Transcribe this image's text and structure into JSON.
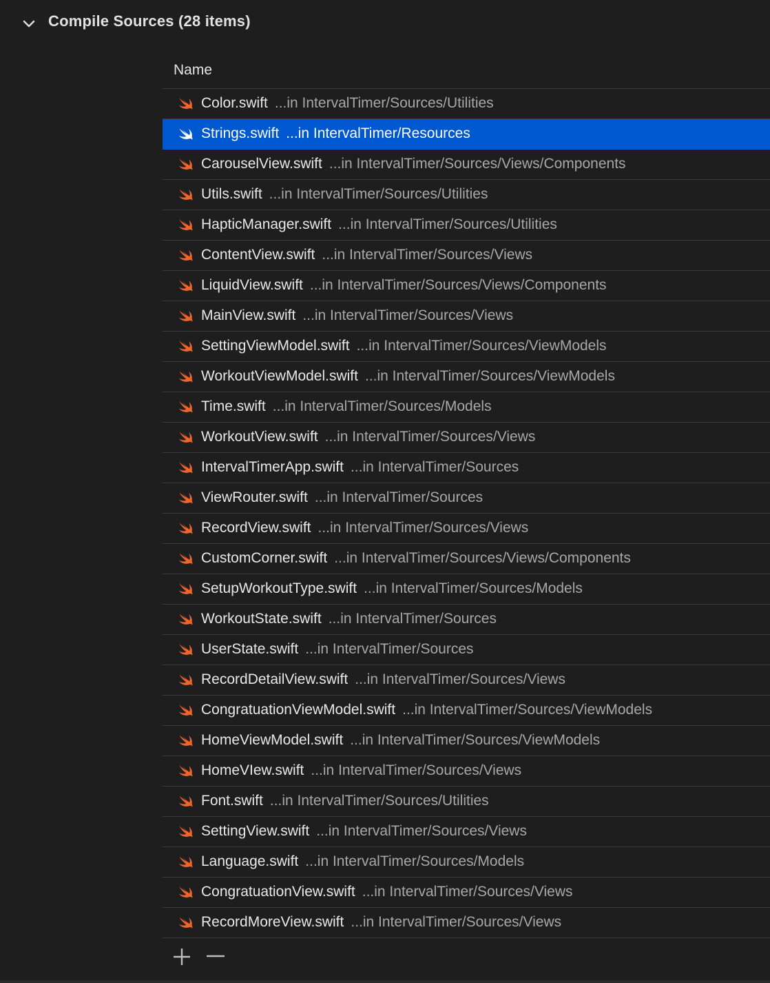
{
  "section": {
    "title": "Compile Sources (28 items)",
    "expanded": true
  },
  "table": {
    "column_header": "Name",
    "rows": [
      {
        "name": "Color.swift",
        "path": "...in IntervalTimer/Sources/Utilities",
        "selected": false
      },
      {
        "name": "Strings.swift",
        "path": "...in IntervalTimer/Resources",
        "selected": true
      },
      {
        "name": "CarouselView.swift",
        "path": "...in IntervalTimer/Sources/Views/Components",
        "selected": false
      },
      {
        "name": "Utils.swift",
        "path": "...in IntervalTimer/Sources/Utilities",
        "selected": false
      },
      {
        "name": "HapticManager.swift",
        "path": "...in IntervalTimer/Sources/Utilities",
        "selected": false
      },
      {
        "name": "ContentView.swift",
        "path": "...in IntervalTimer/Sources/Views",
        "selected": false
      },
      {
        "name": "LiquidView.swift",
        "path": "...in IntervalTimer/Sources/Views/Components",
        "selected": false
      },
      {
        "name": "MainView.swift",
        "path": "...in IntervalTimer/Sources/Views",
        "selected": false
      },
      {
        "name": "SettingViewModel.swift",
        "path": "...in IntervalTimer/Sources/ViewModels",
        "selected": false
      },
      {
        "name": "WorkoutViewModel.swift",
        "path": "...in IntervalTimer/Sources/ViewModels",
        "selected": false
      },
      {
        "name": "Time.swift",
        "path": "...in IntervalTimer/Sources/Models",
        "selected": false
      },
      {
        "name": "WorkoutView.swift",
        "path": "...in IntervalTimer/Sources/Views",
        "selected": false
      },
      {
        "name": "IntervalTimerApp.swift",
        "path": "...in IntervalTimer/Sources",
        "selected": false
      },
      {
        "name": "ViewRouter.swift",
        "path": "...in IntervalTimer/Sources",
        "selected": false
      },
      {
        "name": "RecordView.swift",
        "path": "...in IntervalTimer/Sources/Views",
        "selected": false
      },
      {
        "name": "CustomCorner.swift",
        "path": "...in IntervalTimer/Sources/Views/Components",
        "selected": false
      },
      {
        "name": "SetupWorkoutType.swift",
        "path": "...in IntervalTimer/Sources/Models",
        "selected": false
      },
      {
        "name": "WorkoutState.swift",
        "path": "...in IntervalTimer/Sources",
        "selected": false
      },
      {
        "name": "UserState.swift",
        "path": "...in IntervalTimer/Sources",
        "selected": false
      },
      {
        "name": "RecordDetailView.swift",
        "path": "...in IntervalTimer/Sources/Views",
        "selected": false
      },
      {
        "name": "CongratuationViewModel.swift",
        "path": "...in IntervalTimer/Sources/ViewModels",
        "selected": false
      },
      {
        "name": "HomeViewModel.swift",
        "path": "...in IntervalTimer/Sources/ViewModels",
        "selected": false
      },
      {
        "name": "HomeVIew.swift",
        "path": "...in IntervalTimer/Sources/Views",
        "selected": false
      },
      {
        "name": "Font.swift",
        "path": "...in IntervalTimer/Sources/Utilities",
        "selected": false
      },
      {
        "name": "SettingView.swift",
        "path": "...in IntervalTimer/Sources/Views",
        "selected": false
      },
      {
        "name": "Language.swift",
        "path": "...in IntervalTimer/Sources/Models",
        "selected": false
      },
      {
        "name": "CongratuationView.swift",
        "path": "...in IntervalTimer/Sources/Views",
        "selected": false
      },
      {
        "name": "RecordMoreView.swift",
        "path": "...in IntervalTimer/Sources/Views",
        "selected": false
      }
    ]
  },
  "toolbar": {
    "add_icon": "plus-icon",
    "remove_icon": "minus-icon"
  },
  "colors": {
    "background": "#1e1e1e",
    "selection": "#0058d0",
    "swift_orange": "#f0652a",
    "separator": "#3a3a3a"
  }
}
